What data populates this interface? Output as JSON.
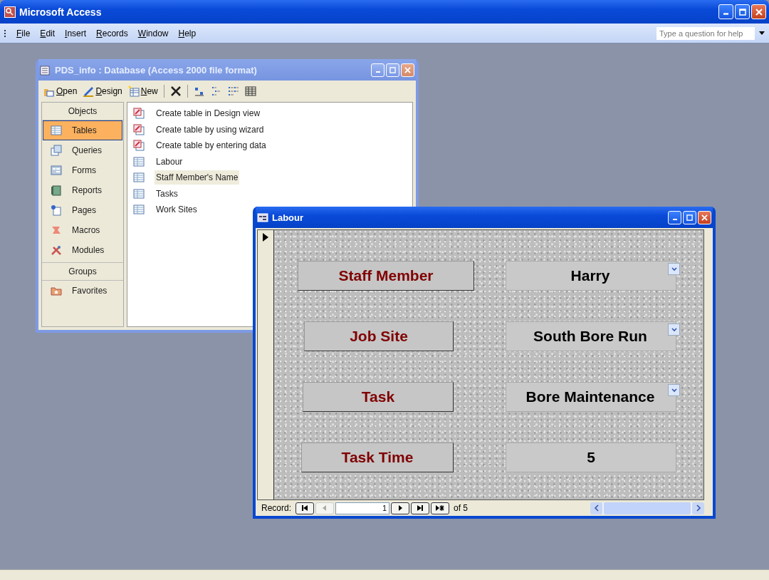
{
  "window": {
    "title": "Microsoft Access"
  },
  "menu": [
    "File",
    "Edit",
    "Insert",
    "Records",
    "Window",
    "Help"
  ],
  "help_box": {
    "placeholder": "Type a question for help"
  },
  "database_window": {
    "title": "PDS_info : Database (Access 2000 file format)",
    "toolbar": [
      {
        "kind": "open",
        "label": "Open"
      },
      {
        "kind": "design",
        "label": "Design"
      },
      {
        "kind": "new",
        "label": "New"
      },
      {
        "kind": "delete"
      },
      {
        "kind": "large-icons"
      },
      {
        "kind": "small-icons"
      },
      {
        "kind": "list"
      },
      {
        "kind": "details"
      }
    ],
    "objects_header": "Objects",
    "objects": [
      {
        "kind": "tables",
        "label": "Tables",
        "selected": true
      },
      {
        "kind": "queries",
        "label": "Queries",
        "selected": false
      },
      {
        "kind": "forms",
        "label": "Forms",
        "selected": false
      },
      {
        "kind": "reports",
        "label": "Reports",
        "selected": false
      },
      {
        "kind": "pages",
        "label": "Pages",
        "selected": false
      },
      {
        "kind": "macros",
        "label": "Macros",
        "selected": false
      },
      {
        "kind": "modules",
        "label": "Modules",
        "selected": false
      }
    ],
    "groups_header": "Groups",
    "groups": [
      {
        "label": "Favorites"
      }
    ],
    "items": [
      {
        "kind": "wizard",
        "label": "Create table in Design view",
        "selected": false
      },
      {
        "kind": "wizard",
        "label": "Create table by using wizard",
        "selected": false
      },
      {
        "kind": "wizard",
        "label": "Create table by entering data",
        "selected": false
      },
      {
        "kind": "table",
        "label": "Labour",
        "selected": false
      },
      {
        "kind": "table",
        "label": "Staff Member's Name",
        "selected": true
      },
      {
        "kind": "table",
        "label": "Tasks",
        "selected": false
      },
      {
        "kind": "table",
        "label": "Work Sites",
        "selected": false
      }
    ]
  },
  "form_window": {
    "title": "Labour",
    "fields": [
      {
        "label": "Staff Member",
        "value": "Harry",
        "kind": "combo"
      },
      {
        "label": "Job Site",
        "value": "South Bore Run",
        "kind": "combo"
      },
      {
        "label": "Task",
        "value": "Bore Maintenance",
        "kind": "combo"
      },
      {
        "label": "Task Time",
        "value": "5",
        "kind": "text"
      }
    ],
    "navigator": {
      "label": "Record:",
      "current": "1",
      "total": "of 5"
    }
  }
}
